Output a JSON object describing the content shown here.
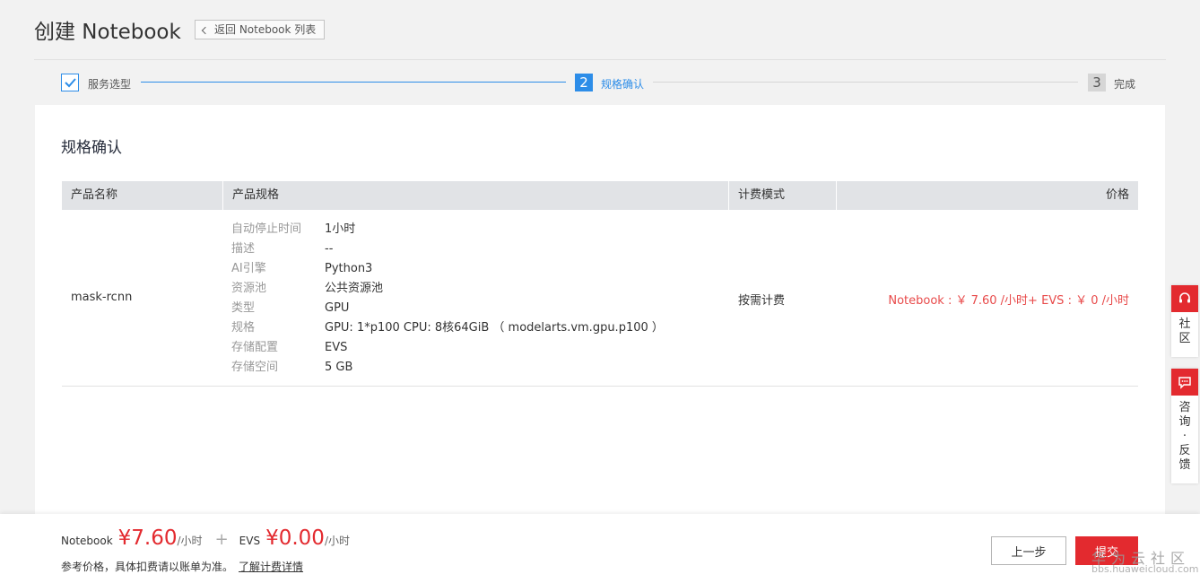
{
  "header": {
    "title": "创建 Notebook",
    "back_label": "返回 Notebook 列表"
  },
  "steps": [
    {
      "label": "服务选型",
      "number": "1",
      "state": "done"
    },
    {
      "label": "规格确认",
      "number": "2",
      "state": "active"
    },
    {
      "label": "完成",
      "number": "3",
      "state": "pending"
    }
  ],
  "card": {
    "title": "规格确认",
    "columns": [
      "产品名称",
      "产品规格",
      "计费模式",
      "价格"
    ],
    "row": {
      "name": "mask-rcnn",
      "specs": [
        {
          "k": "自动停止时间",
          "v": "1小时"
        },
        {
          "k": "描述",
          "v": "--"
        },
        {
          "k": "AI引擎",
          "v": "Python3"
        },
        {
          "k": "资源池",
          "v": "公共资源池"
        },
        {
          "k": "类型",
          "v": "GPU"
        },
        {
          "k": "规格",
          "v": "GPU: 1*p100 CPU: 8核64GiB （ modelarts.vm.gpu.p100 ）"
        },
        {
          "k": "存储配置",
          "v": "EVS"
        },
        {
          "k": "存储空间",
          "v": "5 GB"
        }
      ],
      "billing": "按需计费",
      "price": "Notebook : ￥ 7.60 /小时+ EVS : ￥ 0 /小时"
    }
  },
  "footer": {
    "nb_label": "Notebook",
    "nb_price": "¥7.60",
    "nb_unit": "/小时",
    "plus": "+",
    "evs_label": "EVS",
    "evs_price": "¥0.00",
    "evs_unit": "/小时",
    "note": "参考价格，具体扣费请以账单为准。",
    "link": "了解计费详情",
    "prev_label": "上一步",
    "submit_label": "提交"
  },
  "side": {
    "community": "社\n区",
    "feedback": "咨\n询\n·\n反\n馈"
  },
  "watermark": {
    "line1": "华为云社区",
    "line2": "bbs.huaweicloud.com"
  },
  "colors": {
    "primary": "#2d8de8",
    "danger": "#e32a2f",
    "price_text": "#e84a4a"
  }
}
